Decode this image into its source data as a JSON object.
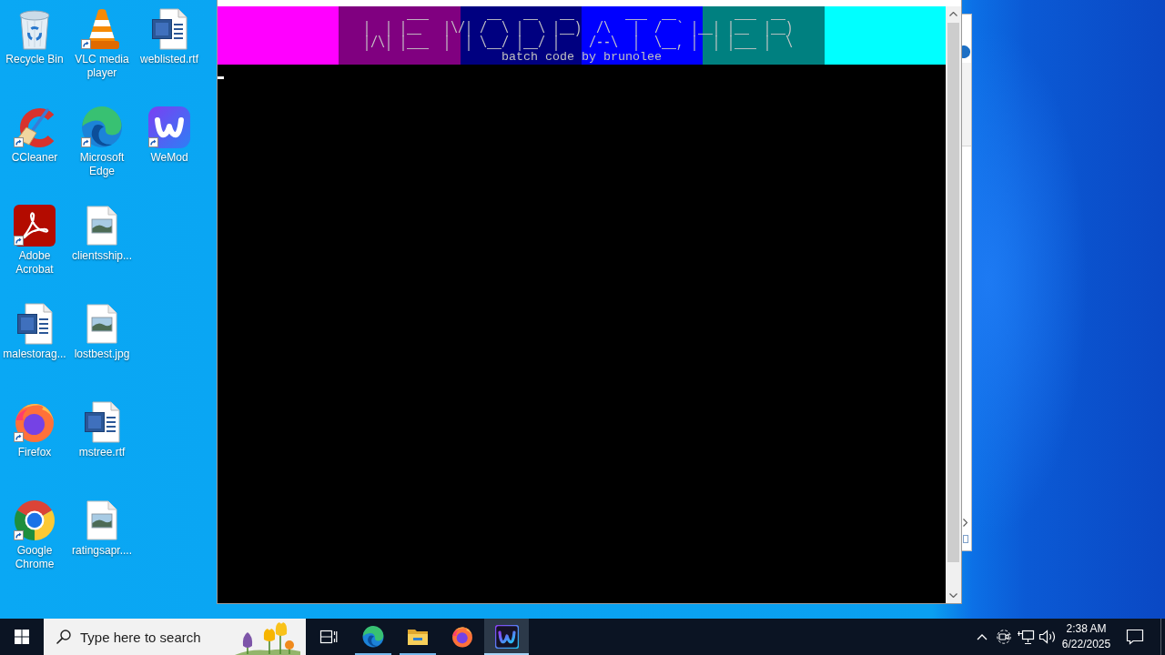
{
  "desktop": {
    "icons": [
      {
        "label": "Recycle Bin",
        "kind": "recycle-bin",
        "shortcut": false
      },
      {
        "label": "CCleaner",
        "kind": "ccleaner",
        "shortcut": true
      },
      {
        "label": "Adobe Acrobat",
        "kind": "acrobat",
        "shortcut": true
      },
      {
        "label": "malestorag...",
        "kind": "word-document",
        "shortcut": false
      },
      {
        "label": "Firefox",
        "kind": "firefox",
        "shortcut": true
      },
      {
        "label": "Google Chrome",
        "kind": "chrome",
        "shortcut": true
      },
      {
        "label": "VLC media player",
        "kind": "vlc",
        "shortcut": true
      },
      {
        "label": "Microsoft Edge",
        "kind": "edge",
        "shortcut": true
      },
      {
        "label": "clientsship...",
        "kind": "image-file",
        "shortcut": false
      },
      {
        "label": "lostbest.jpg",
        "kind": "image-file",
        "shortcut": false
      },
      {
        "label": "mstree.rtf",
        "kind": "word-document",
        "shortcut": false
      },
      {
        "label": "ratingsapr....",
        "kind": "image-file",
        "shortcut": false
      },
      {
        "label": "weblisted.rtf",
        "kind": "word-document",
        "shortcut": false
      },
      {
        "label": "WeMod",
        "kind": "wemod",
        "shortcut": true
      }
    ]
  },
  "console_window": {
    "banner": {
      "bands": [
        {
          "color": "#ff00ff"
        },
        {
          "color": "#800080"
        },
        {
          "color": "#000080"
        },
        {
          "color": "#0000ff"
        },
        {
          "color": "#008080"
        },
        {
          "color": "#00ffff"
        }
      ],
      "art": [
        "      ___        __   __   __       ___  __        ___  __",
        "|  | |__   |\\/| /  \\ |  \\ |__)  /\\   |  /  ` |__| |__  |__)",
        "|/\\| |___  |  | \\__/ |__/ |    /--\\  |  \\__, |  | |___ |  \\"
      ],
      "subtitle": "batch code by brunolee"
    }
  },
  "taskbar": {
    "search": {
      "placeholder": "Type here to search"
    },
    "apps": [
      {
        "kind": "task-view",
        "running": false,
        "active": false
      },
      {
        "kind": "edge",
        "running": true,
        "active": false
      },
      {
        "kind": "file-explorer",
        "running": true,
        "active": false
      },
      {
        "kind": "firefox",
        "running": false,
        "active": false
      },
      {
        "kind": "wemod",
        "running": true,
        "active": true
      }
    ],
    "clock": {
      "time": "2:38 AM",
      "date": "6/22/2025"
    }
  }
}
